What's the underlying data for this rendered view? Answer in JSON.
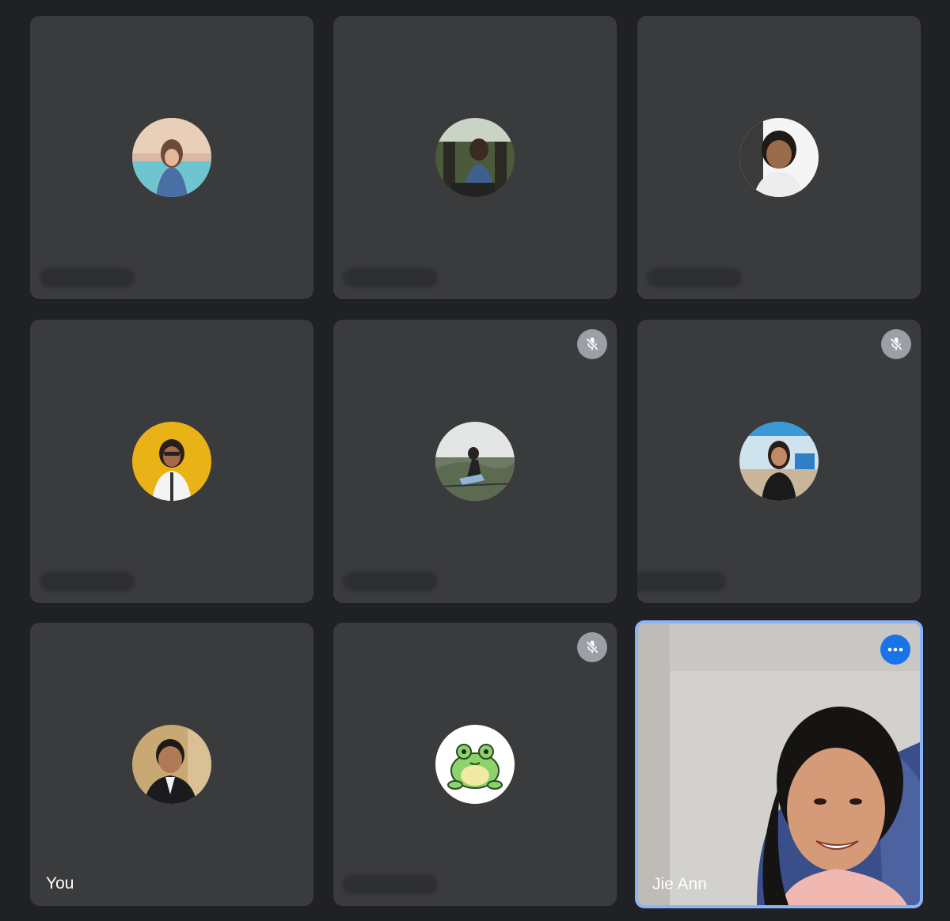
{
  "meeting": {
    "tiles": [
      {
        "id": "p1",
        "name_label": "",
        "muted": false
      },
      {
        "id": "p2",
        "name_label": "",
        "muted": false
      },
      {
        "id": "p3",
        "name_label": "",
        "muted": false
      },
      {
        "id": "p4",
        "name_label": "",
        "muted": false
      },
      {
        "id": "p5",
        "name_label": "",
        "muted": true
      },
      {
        "id": "p6",
        "name_label": "",
        "muted": true
      },
      {
        "id": "self",
        "name_label": "You",
        "muted": false
      },
      {
        "id": "p8",
        "name_label": "",
        "muted": true
      },
      {
        "id": "speaker",
        "name_label": "Jie Ann",
        "muted": false
      }
    ]
  },
  "icons": {
    "mute": "mic-off-icon",
    "more": "more-options-icon",
    "frog": "frog-avatar"
  },
  "colors": {
    "background": "#202124",
    "tile": "#3a3b3d",
    "active_border": "#8ab4f8",
    "more_button": "#1a73e8",
    "mute_badge": "#9aa0a6"
  }
}
